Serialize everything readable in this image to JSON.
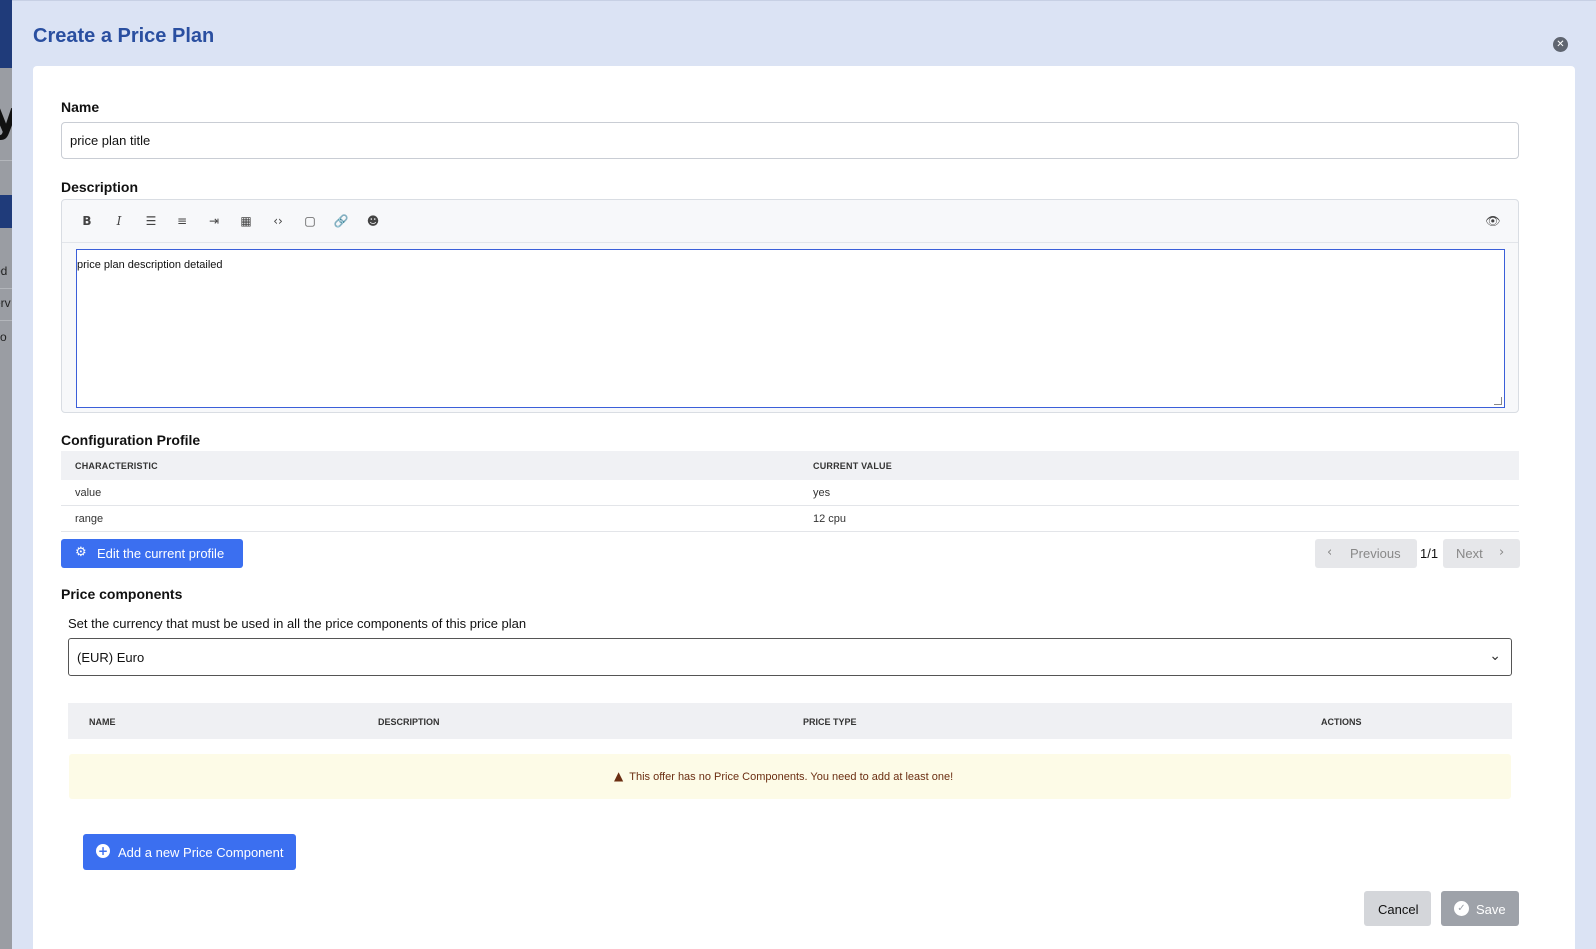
{
  "modal": {
    "title": "Create a Price Plan"
  },
  "name_field": {
    "label": "Name",
    "value": "price plan title"
  },
  "description_field": {
    "label": "Description",
    "toolbar_icons": [
      "bold-icon",
      "italic-icon",
      "bullet-list-icon",
      "numbered-list-icon",
      "indent-icon",
      "table-icon",
      "code-icon",
      "code-block-icon",
      "link-icon",
      "emoji-icon",
      "preview-eye-icon"
    ],
    "value": "price plan description detailed"
  },
  "configuration_profile": {
    "label": "Configuration Profile",
    "columns": [
      "CHARACTERISTIC",
      "CURRENT VALUE"
    ],
    "rows": [
      {
        "characteristic": "value",
        "current_value": "yes"
      },
      {
        "characteristic": "range",
        "current_value": "12 cpu"
      }
    ],
    "edit_button": "Edit the current profile",
    "pagination": {
      "previous": "Previous",
      "page": "1/1",
      "next": "Next"
    }
  },
  "price_components": {
    "label": "Price components",
    "helper": "Set the currency that must be used in all the price components of this price plan",
    "currency": "(EUR) Euro",
    "columns": [
      "NAME",
      "DESCRIPTION",
      "PRICE TYPE",
      "ACTIONS"
    ],
    "warning": "This offer has no Price Components. You need to add at least one!",
    "add_button": "Add a new Price Component"
  },
  "footer": {
    "cancel": "Cancel",
    "save": "Save"
  },
  "background": {
    "big_letter": "y",
    "fragments": [
      "od",
      "erv",
      "so"
    ]
  },
  "colors": {
    "title_blue": "#2a4fa0",
    "primary": "#3b6ff0",
    "warning_bg": "#fdfbe7",
    "warning_text": "#6b2e12"
  }
}
